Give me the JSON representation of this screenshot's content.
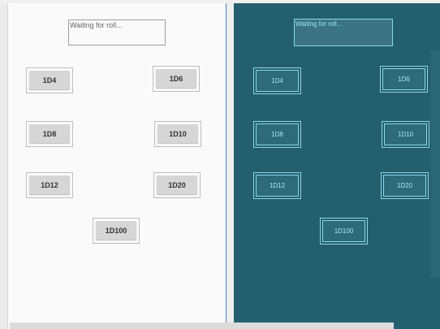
{
  "result_text": "Waiting for roll...",
  "dice": {
    "d4": "1D4",
    "d6": "1D6",
    "d8": "1D8",
    "d10": "1D10",
    "d12": "1D12",
    "d20": "1D20",
    "d100": "1D100"
  }
}
